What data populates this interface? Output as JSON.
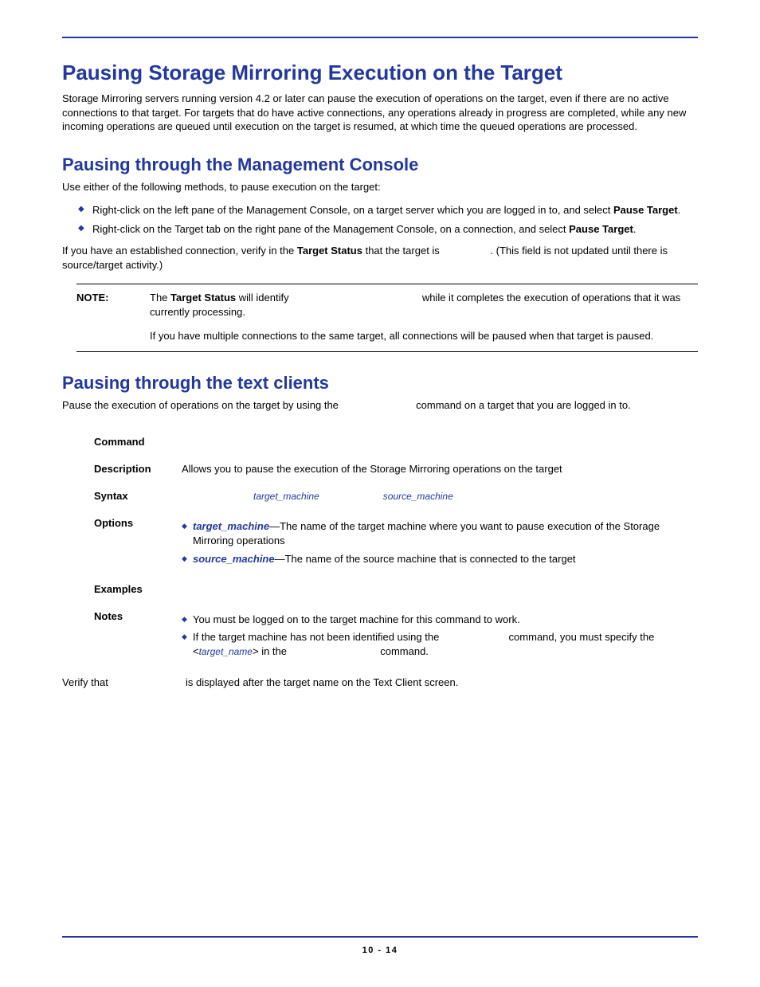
{
  "title": "Pausing Storage Mirroring Execution on the Target",
  "intro": "Storage Mirroring servers running version 4.2 or later can pause the execution of operations on the target, even if there are no active connections to that target.  For targets that do have active connections, any operations already in progress are completed, while any new incoming operations are queued until execution on the target is resumed, at which time the queued operations are processed.",
  "section1": {
    "heading": "Pausing through the Management Console",
    "lead": "Use either of the following methods, to pause execution on the target:",
    "bullet1_pre": "Right-click on the left pane of the Management Console, on a target server which you are logged in to, and select ",
    "bullet1_bold": "Pause Target",
    "bullet1_post": ".",
    "bullet2_pre": "Right-click on the Target tab on the right pane of the Management Console, on a connection, and select ",
    "bullet2_bold": "Pause Target",
    "bullet2_post": ".",
    "after_pre": "If you have an established connection, verify in the ",
    "after_bold": "Target Status",
    "after_mid": " that the target is ",
    "after_post": ".  (This field is not updated until there is source/target activity.)",
    "note_label": "NOTE:",
    "note1_pre": "The ",
    "note1_bold": "Target Status",
    "note1_mid": " will identify ",
    "note1_post": " while it completes the execution of operations that it was currently processing.",
    "note2": "If you have multiple connections to the same target, all connections will be paused when that target is paused."
  },
  "section2": {
    "heading": "Pausing through the text clients",
    "lead_pre": "Pause the execution of operations on the target by using the ",
    "lead_post": " command on a target that you are logged in to.",
    "rows": {
      "command": "Command",
      "description": "Description",
      "syntax": "Syntax",
      "options": "Options",
      "examples": "Examples",
      "notes": "Notes"
    },
    "description_text": "Allows you to pause the execution of the Storage Mirroring operations on the target",
    "syntax_arg1": "target_machine",
    "syntax_arg2": "source_machine",
    "opt1_key": "target_machine",
    "opt1_text": "—The name of the target machine where you want to pause execution of the Storage Mirroring operations",
    "opt2_key": "source_machine",
    "opt2_text": "—The name of the source machine that is connected to the target",
    "note_bullet1": "You must be logged on to the target machine for this command to work.",
    "note_bullet2_pre": "If the target machine has not been identified using the ",
    "note_bullet2_mid": " command, you must specify the ",
    "note_bullet2_arg": "target_name",
    "note_bullet2_mid2": " in the ",
    "note_bullet2_post": " command.",
    "verify_pre": "Verify that ",
    "verify_post": " is displayed after the target name on the Text Client screen."
  },
  "page_number": "10 - 14"
}
